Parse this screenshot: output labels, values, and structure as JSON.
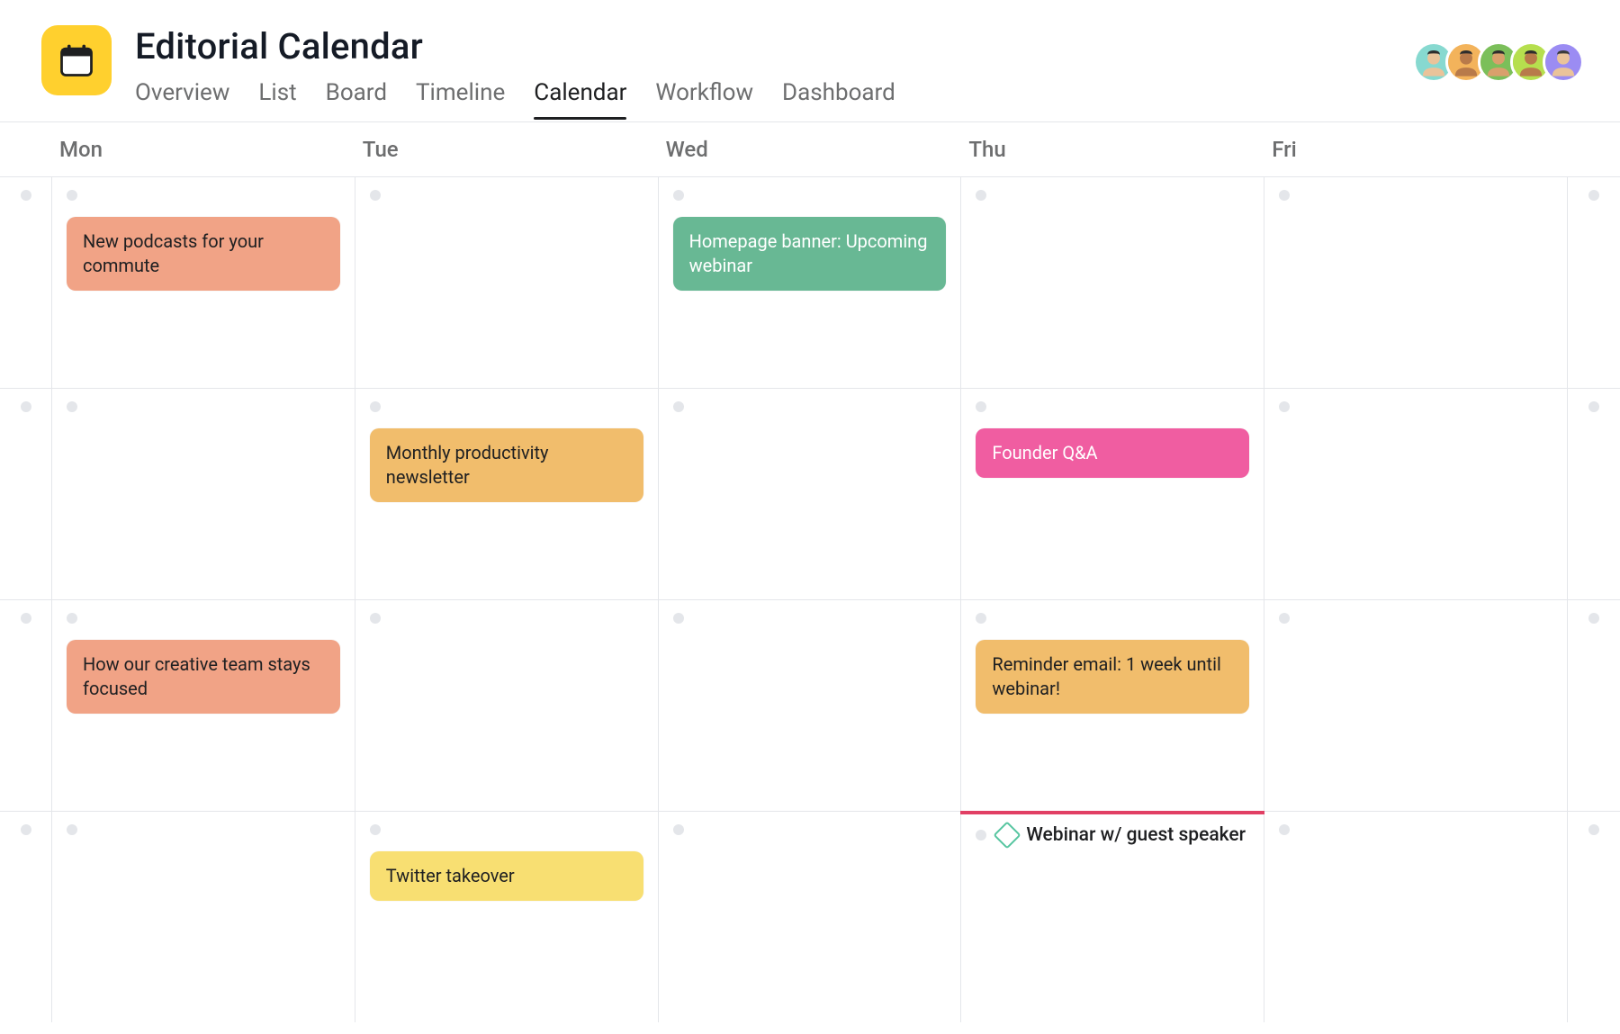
{
  "project": {
    "title": "Editorial Calendar",
    "icon": "calendar-icon"
  },
  "tabs": [
    {
      "label": "Overview",
      "active": false
    },
    {
      "label": "List",
      "active": false
    },
    {
      "label": "Board",
      "active": false
    },
    {
      "label": "Timeline",
      "active": false
    },
    {
      "label": "Calendar",
      "active": true
    },
    {
      "label": "Workflow",
      "active": false
    },
    {
      "label": "Dashboard",
      "active": false
    }
  ],
  "members": [
    {
      "name": "member-1",
      "bg": "#87d9d0",
      "skin": "#eac39a",
      "hair": "#2d2d2d"
    },
    {
      "name": "member-2",
      "bg": "#f3b35b",
      "skin": "#b87a4a",
      "hair": "#2d2d2d"
    },
    {
      "name": "member-3",
      "bg": "#7bbf5a",
      "skin": "#d9a06c",
      "hair": "#2d2d2d"
    },
    {
      "name": "member-4",
      "bg": "#b6df4e",
      "skin": "#b87a4a",
      "hair": "#2d2d2d"
    },
    {
      "name": "member-5",
      "bg": "#9b8cf3",
      "skin": "#eac39a",
      "hair": "#3a3a3a"
    }
  ],
  "weekdays": [
    "Mon",
    "Tue",
    "Wed",
    "Thu",
    "Fri"
  ],
  "weeks": [
    {
      "days": [
        {
          "tasks": [
            {
              "label": "New podcasts for your commute",
              "color": "orange"
            }
          ]
        },
        {
          "tasks": []
        },
        {
          "tasks": [
            {
              "label": "Homepage banner: Upcoming webinar",
              "color": "green"
            }
          ]
        },
        {
          "tasks": []
        },
        {
          "tasks": []
        }
      ]
    },
    {
      "days": [
        {
          "tasks": []
        },
        {
          "tasks": [
            {
              "label": "Monthly productivity newsletter",
              "color": "amber"
            }
          ]
        },
        {
          "tasks": []
        },
        {
          "tasks": [
            {
              "label": "Founder Q&A",
              "color": "pink"
            }
          ]
        },
        {
          "tasks": []
        }
      ]
    },
    {
      "days": [
        {
          "tasks": [
            {
              "label": "How our creative team stays focused",
              "color": "orange"
            }
          ]
        },
        {
          "tasks": []
        },
        {
          "tasks": []
        },
        {
          "tasks": [
            {
              "label": "Reminder email: 1 week until webinar!",
              "color": "amber"
            }
          ]
        },
        {
          "tasks": []
        }
      ]
    },
    {
      "days": [
        {
          "tasks": []
        },
        {
          "tasks": [
            {
              "label": "Twitter takeover",
              "color": "yellow"
            }
          ]
        },
        {
          "tasks": []
        },
        {
          "today": true,
          "milestone": {
            "label": "Webinar w/ guest speaker"
          }
        },
        {
          "tasks": []
        }
      ]
    }
  ]
}
